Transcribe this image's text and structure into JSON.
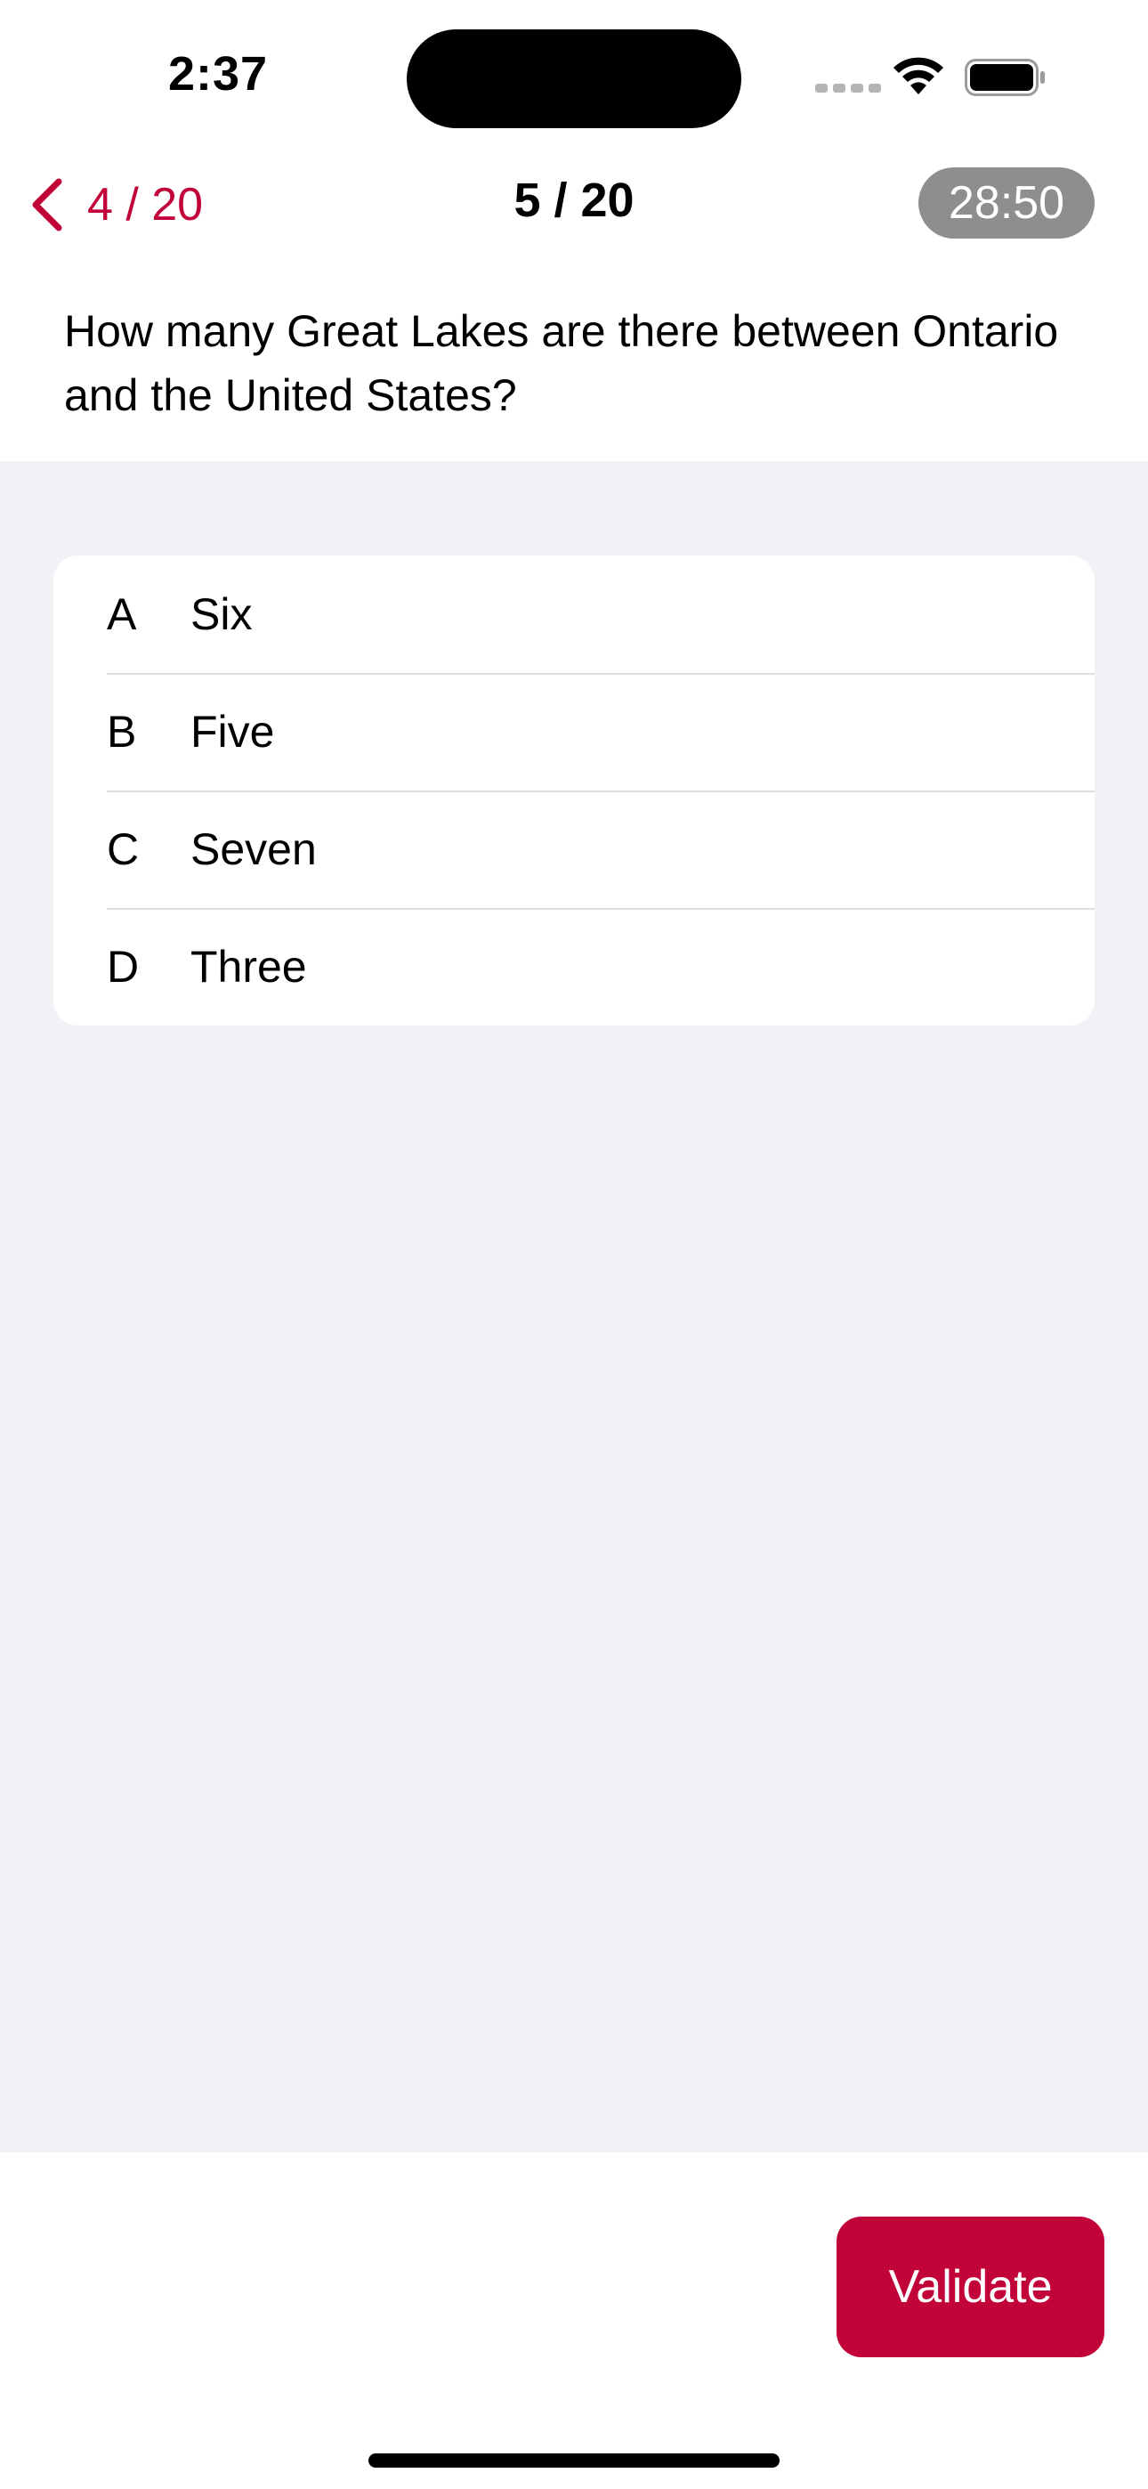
{
  "status_bar": {
    "time": "2:37"
  },
  "nav": {
    "back_label": "4 / 20",
    "title": "5 / 20",
    "timer": "28:50"
  },
  "question": {
    "text": "How many Great Lakes are there between Ontario and the United States?"
  },
  "answers": [
    {
      "letter": "A",
      "text": "Six"
    },
    {
      "letter": "B",
      "text": "Five"
    },
    {
      "letter": "C",
      "text": "Seven"
    },
    {
      "letter": "D",
      "text": "Three"
    }
  ],
  "footer": {
    "validate_label": "Validate"
  },
  "colors": {
    "accent": "#c1033a",
    "timer_badge": "#8e8e8e",
    "content_background": "#f1f1f6"
  },
  "icons": {
    "back": "chevron-left-icon",
    "signal": "cellular-signal-icon",
    "wifi": "wifi-icon",
    "battery": "battery-icon"
  }
}
